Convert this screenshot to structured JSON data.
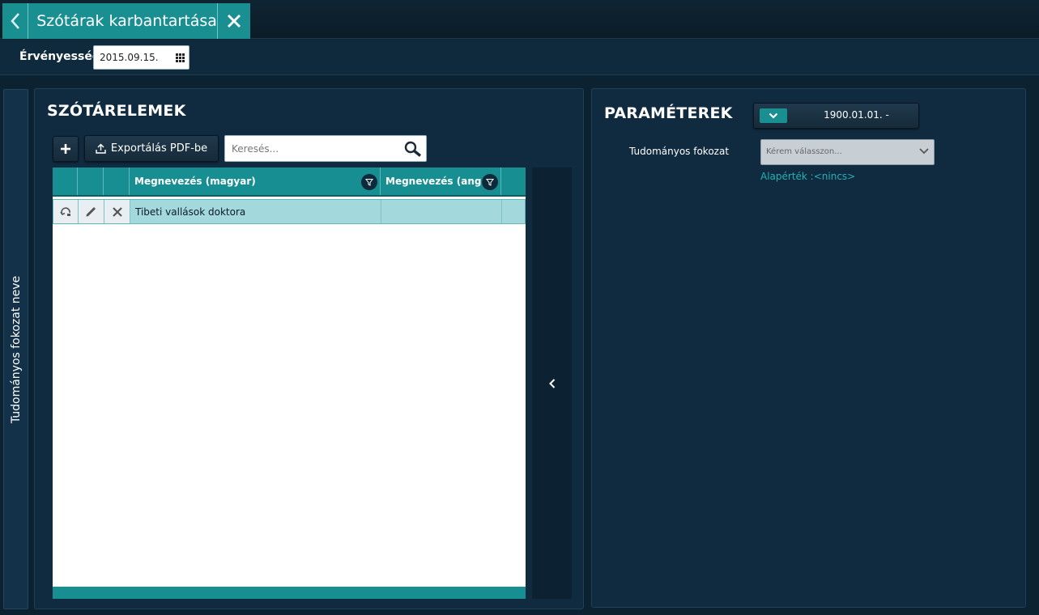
{
  "window": {
    "title": "Szótárak karbantartása"
  },
  "validity": {
    "label": "Érvényesség",
    "date": "2015.09.15."
  },
  "side_tab": {
    "label": "Tudományos fokozat neve"
  },
  "dictionary": {
    "title": "SZÓTÁRELEMEK",
    "export_label": "Exportálás PDF-be",
    "search_placeholder": "Keresés...",
    "columns": [
      "Megnevezés (magyar)",
      "Megnevezés (angol)"
    ],
    "rows": [
      {
        "hungarian": "Tibeti vallások doktora",
        "english": ""
      }
    ]
  },
  "parameters": {
    "title": "PARAMÉTEREK",
    "date_range": "1900.01.01. -",
    "field_label": "Tudományos fokozat",
    "select_placeholder": "Kérem válasszon...",
    "default_text": "Alapérték :<nincs>"
  },
  "colors": {
    "accent": "#1a8f92",
    "panel": "#102a40",
    "row_selected": "#a3d9dc",
    "default_link": "#1fb3b6"
  }
}
